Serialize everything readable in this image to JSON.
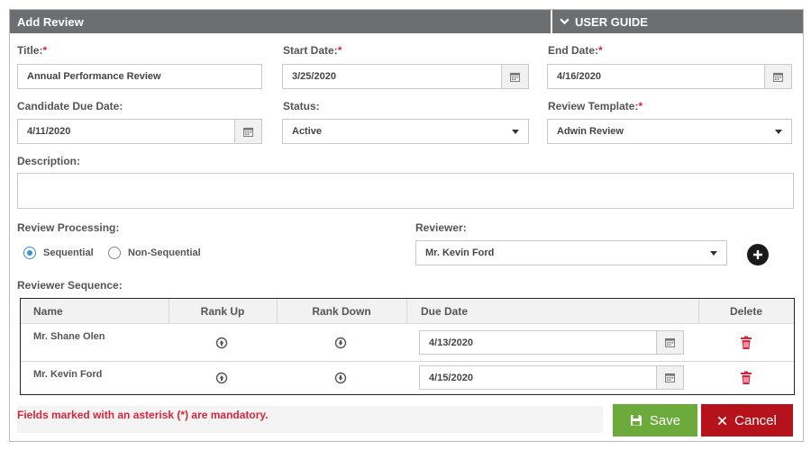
{
  "header": {
    "title": "Add Review",
    "guide_label": "USER GUIDE"
  },
  "form": {
    "title_label": "Title:",
    "title_value": "Annual Performance Review",
    "start_label": "Start Date:",
    "start_value": "3/25/2020",
    "end_label": "End Date:",
    "end_value": "4/16/2020",
    "candidate_due_label": "Candidate Due Date:",
    "candidate_due_value": "4/11/2020",
    "status_label": "Status:",
    "status_value": "Active",
    "template_label": "Review Template:",
    "template_value": "Adwin Review",
    "description_label": "Description:",
    "description_value": "",
    "required_marker": "*"
  },
  "processing": {
    "label": "Review Processing:",
    "options": [
      "Sequential",
      "Non-Sequential"
    ],
    "selected": "Sequential"
  },
  "reviewer": {
    "label": "Reviewer:",
    "value": "Mr. Kevin Ford"
  },
  "sequence": {
    "label": "Reviewer Sequence:",
    "columns": [
      "Name",
      "Rank Up",
      "Rank Down",
      "Due Date",
      "Delete"
    ],
    "rows": [
      {
        "name": "Mr. Shane Olen",
        "due": "4/13/2020"
      },
      {
        "name": "Mr. Kevin Ford",
        "due": "4/15/2020"
      }
    ]
  },
  "footer": {
    "mandatory_note": "Fields marked with an asterisk (*) are mandatory.",
    "save_label": "Save",
    "cancel_label": "Cancel"
  },
  "icons": {
    "guide": "chevron-down-icon",
    "calendar": "calendar-icon",
    "dropdown": "caret-down-icon",
    "add": "plus-circle-icon",
    "rank_up": "arrow-up-circle-icon",
    "rank_down": "arrow-down-circle-icon",
    "delete": "trash-icon",
    "save": "floppy-disk-icon",
    "cancel": "close-icon"
  },
  "colors": {
    "header": "#6d6e70",
    "required": "#d9253b",
    "radio_selected": "#3a90d8",
    "save": "#6cab3b",
    "cancel": "#b5121b",
    "delete": "#d9253b"
  }
}
